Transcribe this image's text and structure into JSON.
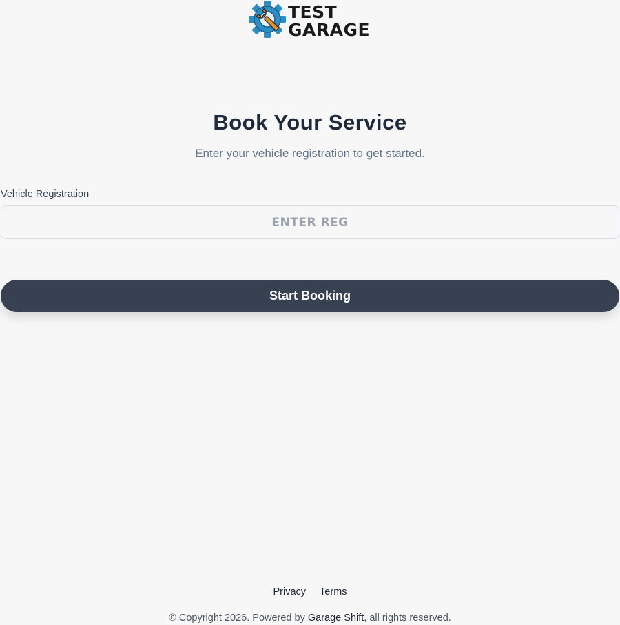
{
  "header": {
    "logo": {
      "line1": "TEST",
      "line2": "GARAGE",
      "icon": "gear-wrench-icon",
      "colors": {
        "gear": "#2b8fc7",
        "wrench": "#e8912c",
        "text": "#1a1a1a"
      }
    }
  },
  "main": {
    "title": "Book Your Service",
    "subtitle": "Enter your vehicle registration to get started.",
    "registration": {
      "label": "Vehicle Registration",
      "value": "",
      "placeholder": "ENTER REG"
    },
    "start_button_label": "Start Booking"
  },
  "footer": {
    "links": [
      "Privacy",
      "Terms"
    ],
    "copyright_prefix": "© Copyright 2026. Powered by ",
    "copyright_brand": "Garage Shift",
    "copyright_suffix": ", all rights reserved."
  },
  "colors": {
    "background": "#f7f7f7",
    "button": "#374151",
    "title": "#1e293b",
    "subtitle": "#64748b"
  }
}
